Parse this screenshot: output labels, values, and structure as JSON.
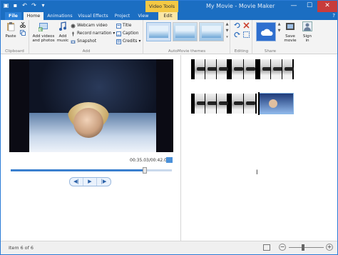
{
  "window": {
    "title": "My Movie - Movie Maker",
    "contextual_tab": "Video Tools",
    "buttons": {
      "minimize": "—",
      "maximize": "☐",
      "close": "✕"
    }
  },
  "quick_access": [
    "save-icon",
    "undo-icon",
    "redo-icon"
  ],
  "tabs": {
    "file": "File",
    "home": "Home",
    "animations": "Animations",
    "visual_effects": "Visual Effects",
    "project": "Project",
    "view": "View",
    "edit": "Edit"
  },
  "ribbon": {
    "clipboard": {
      "label": "Clipboard",
      "paste": "Paste"
    },
    "add": {
      "label": "Add",
      "add_videos": "Add videos and photos",
      "add_music": "Add music",
      "webcam": "Webcam video",
      "narration": "Record narration",
      "snapshot": "Snapshot",
      "title": "Title",
      "caption": "Caption",
      "credits": "Credits"
    },
    "automovie": {
      "label": "AutoMovie themes"
    },
    "editing": {
      "label": "Editing"
    },
    "share": {
      "label": "Share",
      "save_movie": "Save movie",
      "sign_in": "Sign in"
    }
  },
  "preview": {
    "timecode": "00:35.03/00:42.00",
    "progress_fraction": 0.83,
    "controls": [
      "◀|",
      "▶",
      "|▶"
    ]
  },
  "storyboard": {
    "rows": [
      {
        "clips": [
          4,
          4,
          4
        ]
      },
      {
        "clips": [
          4,
          4,
          1
        ]
      }
    ]
  },
  "status": {
    "text": "Item 6 of 6",
    "zoom_fraction": 0.4
  },
  "colors": {
    "titlebar": "#1b6ec2",
    "accent": "#3a7fcf",
    "contextual": "#f3c844"
  }
}
